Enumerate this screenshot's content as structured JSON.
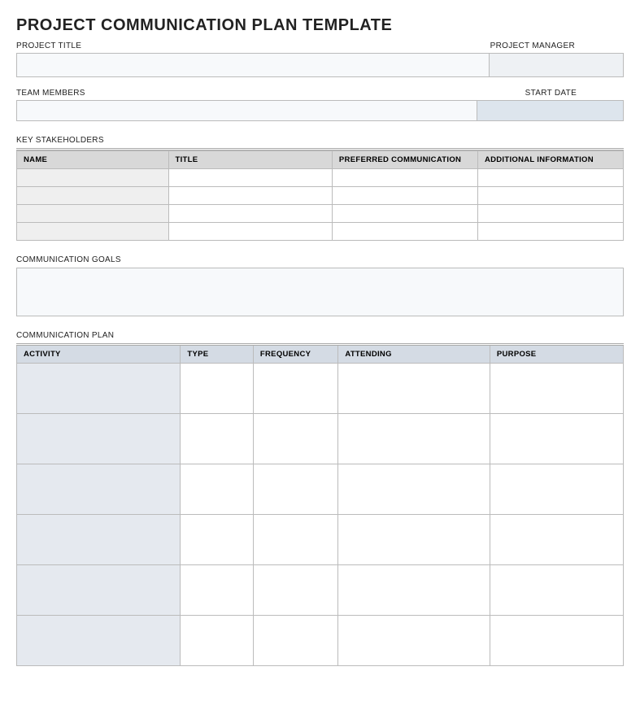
{
  "title": "PROJECT COMMUNICATION PLAN TEMPLATE",
  "fields": {
    "project_title_label": "PROJECT TITLE",
    "project_title_value": "",
    "project_manager_label": "PROJECT MANAGER",
    "project_manager_value": "",
    "team_members_label": "TEAM MEMBERS",
    "team_members_value": "",
    "start_date_label": "START DATE",
    "start_date_value": ""
  },
  "stakeholders": {
    "section_label": "KEY STAKEHOLDERS",
    "headers": {
      "name": "NAME",
      "title": "TITLE",
      "pref_comm": "PREFERRED COMMUNICATION",
      "additional": "ADDITIONAL INFORMATION"
    },
    "rows": [
      {
        "name": "",
        "title": "",
        "pref_comm": "",
        "additional": ""
      },
      {
        "name": "",
        "title": "",
        "pref_comm": "",
        "additional": ""
      },
      {
        "name": "",
        "title": "",
        "pref_comm": "",
        "additional": ""
      },
      {
        "name": "",
        "title": "",
        "pref_comm": "",
        "additional": ""
      }
    ]
  },
  "goals": {
    "section_label": "COMMUNICATION GOALS",
    "value": ""
  },
  "plan": {
    "section_label": "COMMUNICATION PLAN",
    "headers": {
      "activity": "ACTIVITY",
      "type": "TYPE",
      "frequency": "FREQUENCY",
      "attending": "ATTENDING",
      "purpose": "PURPOSE"
    },
    "rows": [
      {
        "activity": "",
        "type": "",
        "frequency": "",
        "attending": "",
        "purpose": ""
      },
      {
        "activity": "",
        "type": "",
        "frequency": "",
        "attending": "",
        "purpose": ""
      },
      {
        "activity": "",
        "type": "",
        "frequency": "",
        "attending": "",
        "purpose": ""
      },
      {
        "activity": "",
        "type": "",
        "frequency": "",
        "attending": "",
        "purpose": ""
      },
      {
        "activity": "",
        "type": "",
        "frequency": "",
        "attending": "",
        "purpose": ""
      },
      {
        "activity": "",
        "type": "",
        "frequency": "",
        "attending": "",
        "purpose": ""
      }
    ]
  }
}
